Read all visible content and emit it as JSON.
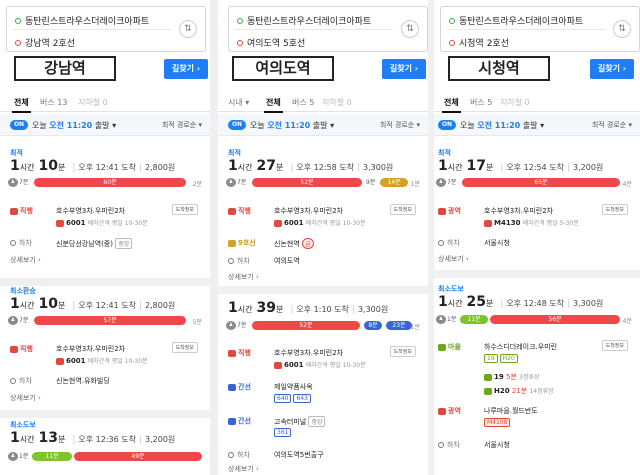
{
  "panels": [
    {
      "origin": "동탄린스트라우스더레이크아파트",
      "destination": "강남역 2호선",
      "station_label": "강남역",
      "find_button": "길찾기",
      "tabs": [
        "전체",
        "버스 13",
        "지하철 0"
      ],
      "on_badge": "ON",
      "depart_prefix": "오늘",
      "depart_time": "오전 11:20",
      "depart_suffix": "출발",
      "sort": "최적 경로순",
      "routes": [
        {
          "type": "최적",
          "hours": "1",
          "hour_unit": "시간",
          "mins": "10",
          "min_unit": "분",
          "arrival": "오후 12:41 도착",
          "fare": "2,800원",
          "walk_start": "7분",
          "segment": "60분",
          "walk_end": "2분",
          "steps": [
            {
              "mode": "직행",
              "name": "호수부영3차.우미린2차",
              "detail": "도착정보",
              "bus": "6001",
              "interval": "배차간격 평일 10-30분"
            },
            {
              "mode": "하차",
              "name": "신분당선강남역(중)",
              "tag": "중앙"
            }
          ],
          "more": "상세보기"
        },
        {
          "type": "최소환승",
          "hours": "1",
          "hour_unit": "시간",
          "mins": "10",
          "min_unit": "분",
          "arrival": "오후 12:41 도착",
          "fare": "2,800원",
          "walk_start": "7분",
          "segment": "57분",
          "walk_end": "5분",
          "steps": [
            {
              "mode": "직행",
              "name": "호수부영3차.우미린2차",
              "detail": "도착정보",
              "bus": "6001",
              "interval": "배차간격 평일 10-30분"
            },
            {
              "mode": "하차",
              "name": "신논현역.유화빌딩"
            }
          ],
          "more": "상세보기"
        },
        {
          "type": "최소도보",
          "hours": "1",
          "hour_unit": "시간",
          "mins": "13",
          "min_unit": "분",
          "arrival": "오후 12:36 도착",
          "fare": "3,200원",
          "walk_start": "1분",
          "segment_green": "11분",
          "segment": "49분"
        }
      ]
    },
    {
      "origin": "동탄린스트라우스더레이크아파트",
      "destination": "여의도역 5호선",
      "station_label": "여의도역",
      "find_button": "길찾기",
      "tabs": [
        "시내",
        "전체",
        "버스 5",
        "지하철 0"
      ],
      "on_badge": "ON",
      "depart_prefix": "오늘",
      "depart_time": "오전 11:20",
      "depart_suffix": "출발",
      "sort": "최적 경로순",
      "routes": [
        {
          "type": "최적",
          "hours": "1",
          "hour_unit": "시간",
          "mins": "27",
          "min_unit": "분",
          "arrival": "오후 12:58 도착",
          "fare": "3,300원",
          "walk_start": "7분",
          "segment": "52분",
          "walk_mid": "9분",
          "segment_yellow": "14분",
          "walk_end": "1분",
          "steps": [
            {
              "mode": "직행",
              "name": "호수부영3차.우미린2차",
              "detail": "도착정보",
              "bus": "6001",
              "interval": "배차간격 평일 10-30분"
            },
            {
              "mode": "9호선",
              "name": "신논현역",
              "tag": "급"
            },
            {
              "mode": "하차",
              "name": "여의도역"
            }
          ],
          "more": "상세보기"
        },
        {
          "type": "",
          "hours": "1",
          "hour_unit": "시간",
          "mins": "39",
          "min_unit": "분",
          "arrival": "오후 1:10 도착",
          "fare": "3,300원",
          "walk_start": "7분",
          "segment": "52분",
          "segment_blue": "8분",
          "segment_blue2": "23분",
          "walk_end": "1분",
          "steps": [
            {
              "mode": "직행",
              "name": "호수부영3차.우미린2차",
              "detail": "도착정보",
              "bus": "6001",
              "interval": "배차간격 평일 10-30분"
            },
            {
              "mode": "간선",
              "name": "제일약품사옥",
              "tags": [
                "640",
                "643"
              ]
            },
            {
              "mode": "간선",
              "name": "고속터미널",
              "tag_gray": "중앙",
              "tags": [
                "361"
              ]
            },
            {
              "mode": "하차",
              "name": "여의도역5번출구"
            }
          ],
          "more": "상세보기"
        }
      ]
    },
    {
      "origin": "동탄린스트라우스더레이크아파트",
      "destination": "시청역 2호선",
      "station_label": "시청역",
      "find_button": "길찾기",
      "tabs": [
        "전체",
        "버스 5",
        "지하철 0"
      ],
      "on_badge": "ON",
      "depart_prefix": "오늘",
      "depart_time": "오전 11:20",
      "depart_suffix": "출발",
      "sort": "최적 경로순",
      "routes": [
        {
          "type": "최적",
          "hours": "1",
          "hour_unit": "시간",
          "mins": "17",
          "min_unit": "분",
          "arrival": "오후 12:54 도착",
          "fare": "3,200원",
          "walk_start": "7분",
          "segment": "65분",
          "walk_end": "4분",
          "steps": [
            {
              "mode": "광역",
              "name": "호수부영3차.우미린2차",
              "detail": "도착정보",
              "bus": "M4130",
              "interval": "배차간격 평일 5-30분"
            },
            {
              "mode": "하차",
              "name": "서울시청"
            }
          ],
          "more": "상세보기"
        },
        {
          "type": "최소도보",
          "hours": "1",
          "hour_unit": "시간",
          "mins": "25",
          "min_unit": "분",
          "arrival": "오후 12:48 도착",
          "fare": "3,300원",
          "walk_start": "1분",
          "segment_green": "11분",
          "segment": "56분",
          "walk_end": "4분",
          "steps": [
            {
              "mode": "마을",
              "name": "하수스디더레이크.우미린",
              "detail": "도착정보",
              "tags": [
                "19",
                "H20"
              ],
              "bus_a": "19",
              "bus_a_time": "5분",
              "bus_a_stops": "3정류장",
              "bus_b": "H20",
              "bus_b_time": "21분",
              "bus_b_stops": "14정류장"
            },
            {
              "mode": "광역",
              "name": "나루마을.월드반도",
              "tag_red": "M4108"
            },
            {
              "mode": "하차",
              "name": "서울시청"
            }
          ]
        }
      ]
    }
  ],
  "colors": {
    "accent": "#1d7ef5",
    "bus_red": "#f04848",
    "bus_green": "#7ec42b",
    "bus_blue": "#3b63d8",
    "subway_yellow": "#d4a325"
  }
}
